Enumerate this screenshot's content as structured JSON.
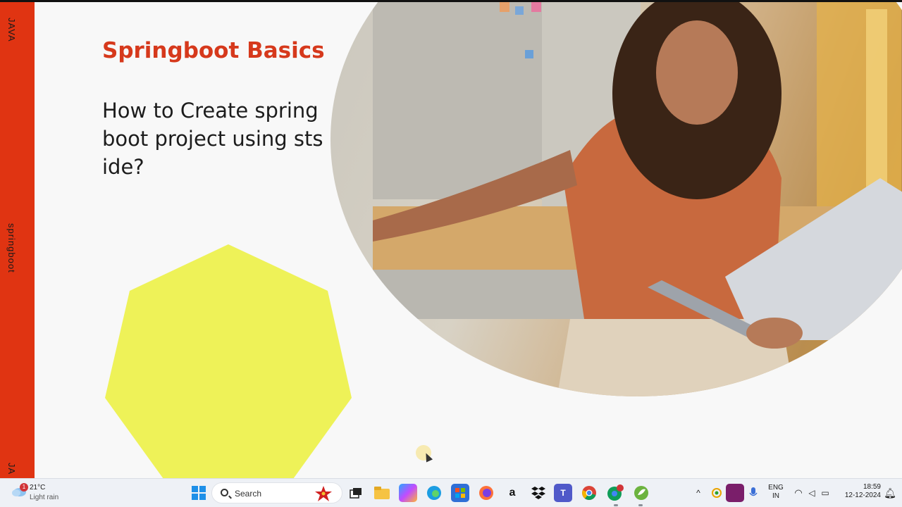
{
  "sidebar": {
    "top_label": "JAVA",
    "mid_label": "springboot",
    "bottom_label": "JA"
  },
  "slide": {
    "title": "Springboot Basics",
    "subtitle": "How to Create spring boot project using sts ide?",
    "accent_color": "#e03412",
    "shape_color": "#eef258"
  },
  "taskbar": {
    "weather": {
      "temperature": "21°C",
      "condition": "Light rain",
      "badge": "1"
    },
    "search_placeholder": "Search",
    "apps": [
      "start-icon",
      "task-view-icon",
      "file-explorer-icon",
      "copilot-icon",
      "edge-icon",
      "microsoft-store-icon",
      "firefox-icon",
      "amazon-icon",
      "dropbox-icon",
      "teams-icon",
      "chrome-icon",
      "chrome-profile-icon",
      "spring-tool-suite-icon"
    ],
    "tray": {
      "language_line1": "ENG",
      "language_line2": "IN",
      "time": "18:59",
      "date": "12-12-2024"
    }
  }
}
